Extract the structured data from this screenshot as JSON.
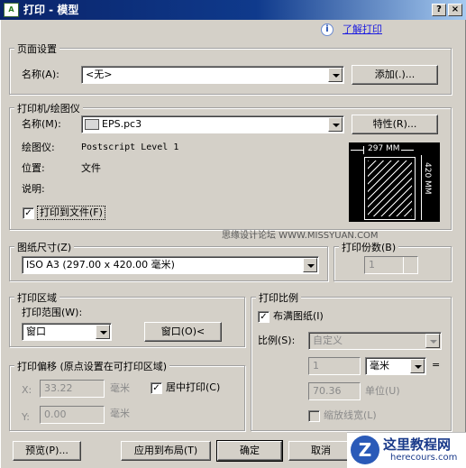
{
  "window": {
    "title": "打印 - 模型",
    "app_icon": "A",
    "help_btn": "?",
    "close_btn": "×"
  },
  "help": {
    "icon": "i",
    "link": "了解打印"
  },
  "page_setup": {
    "group": "页面设置",
    "name_label": "名称(A):",
    "name_value": "<无>",
    "add_btn": "添加(.)..."
  },
  "printer": {
    "group": "打印机/绘图仪",
    "name_label": "名称(M):",
    "name_value": "EPS.pc3",
    "props_btn": "特性(R)...",
    "plotter_label": "绘图仪:",
    "plotter_value": "Postscript Level 1",
    "location_label": "位置:",
    "location_value": "文件",
    "desc_label": "说明:",
    "print_to_file": "打印到文件(F)",
    "print_to_file_checked": true,
    "preview_width": "297 MM",
    "preview_height": "420 MM"
  },
  "watermark": "思缘设计论坛  WWW.MISSYUAN.COM",
  "paper": {
    "group": "图纸尺寸(Z)",
    "value": "ISO A3 (297.00 x 420.00 毫米)"
  },
  "copies": {
    "group": "打印份数(B)",
    "value": "1"
  },
  "area": {
    "group": "打印区域",
    "range_label": "打印范围(W):",
    "range_value": "窗口",
    "window_btn": "窗口(O)<"
  },
  "scale": {
    "group": "打印比例",
    "fit_label": "布满图纸(I)",
    "fit_checked": true,
    "scale_label": "比例(S):",
    "scale_value": "自定义",
    "value1": "1",
    "unit_value": "毫米",
    "equals": "=",
    "value2": "70.36",
    "unit_label": "单位(U)",
    "lineweight_label": "缩放线宽(L)"
  },
  "offset": {
    "group": "打印偏移 (原点设置在可打印区域)",
    "x_label": "X:",
    "x_value": "33.22",
    "x_unit": "毫米",
    "center_label": "居中打印(C)",
    "center_checked": true,
    "y_label": "Y:",
    "y_value": "0.00",
    "y_unit": "毫米"
  },
  "buttons": {
    "preview": "预览(P)...",
    "apply": "应用到布局(T)",
    "ok": "确定",
    "cancel": "取消"
  },
  "logo": {
    "mark": "Z",
    "cn": "这里教程网",
    "url": "herecours.com"
  }
}
